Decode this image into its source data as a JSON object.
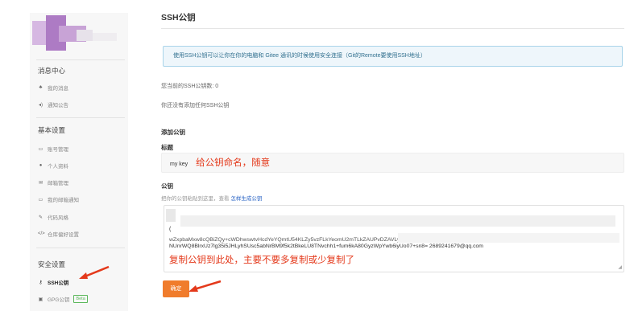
{
  "sidebar": {
    "message_center": {
      "title": "消息中心",
      "items": [
        {
          "label": "我的消息",
          "icon": "bell-icon"
        },
        {
          "label": "通知公告",
          "icon": "megaphone-icon"
        }
      ]
    },
    "basic_settings": {
      "title": "基本设置",
      "items": [
        {
          "label": "账号管理",
          "icon": "id-card-icon"
        },
        {
          "label": "个人资料",
          "icon": "user-icon"
        },
        {
          "label": "邮箱管理",
          "icon": "envelope-icon"
        },
        {
          "label": "我的邮箱通知",
          "icon": "card-icon"
        },
        {
          "label": "代码风格",
          "icon": "brush-icon"
        },
        {
          "label": "仓库偏好设置",
          "icon": "code-icon"
        }
      ]
    },
    "security_settings": {
      "title": "安全设置",
      "items": [
        {
          "label": "SSH公钥",
          "icon": "key-icon",
          "active": true
        },
        {
          "label": "GPG公钥",
          "icon": "lock-icon",
          "badge": "Beta"
        }
      ]
    }
  },
  "main": {
    "title": "SSH公钥",
    "info": "使用SSH公钥可以让你在你的电脑和 Gitee 通讯的时候使用安全连接（Git的Remote要使用SSH地址）",
    "current_count": "您当前的SSH公钥数: 0",
    "no_keys": "你还没有添加任何SSH公钥",
    "add_heading": "添加公钥",
    "title_label": "标题",
    "title_value": "my key",
    "title_annotation": "给公钥命名，随意",
    "key_label": "公钥",
    "key_hint": "把你的公钥粘贴到这里，查看",
    "key_hint_link": "怎样生成公钥",
    "key_value_start": "(",
    "key_line1": "wZxpbaMxw8cQBiZQy+cWDhwswtvHcdYeYQmtU54KLZy5vzFLkYeomU2mTLkZAUPvDZAVLyJrNcpsaz5d",
    "key_line2": "NUnrWQ8BlrxUz7lg35i5JHLyhSUsc5abNrBM9f5k2tBkeLU8TNvchh1+fum6kA80GyzWpYwb6iyUo07+sn8= 2689241679@qq.com",
    "key_annotation": "复制公钥到此处，主要不要多复制或少复制了",
    "confirm_label": "确定"
  },
  "colors": {
    "accent_orange": "#f07c2c",
    "annotation_red": "#e4391b",
    "info_bg": "#eef6fb",
    "info_border": "#a9d4ea",
    "link_blue": "#2a64c5"
  }
}
